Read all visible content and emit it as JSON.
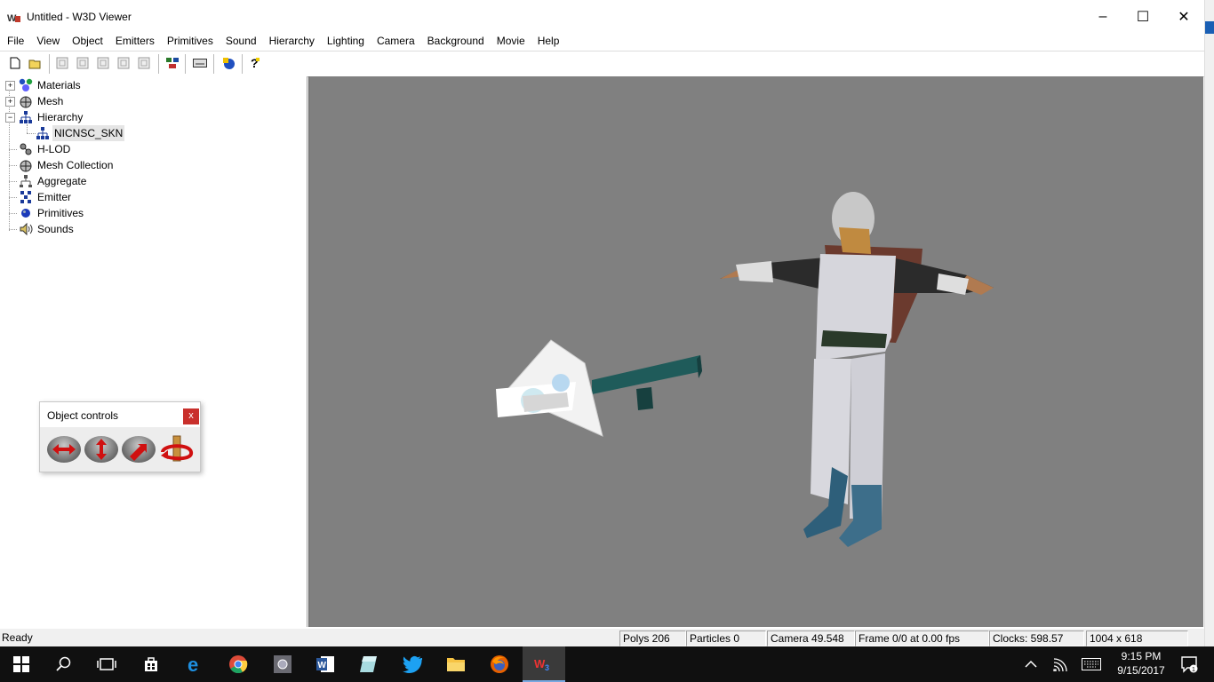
{
  "window": {
    "title": "Untitled - W3D Viewer",
    "minimize": "–",
    "maximize": "☐",
    "close": "✕"
  },
  "menubar": [
    "File",
    "View",
    "Object",
    "Emitters",
    "Primitives",
    "Sound",
    "Hierarchy",
    "Lighting",
    "Camera",
    "Background",
    "Movie",
    "Help"
  ],
  "tree": {
    "materials": "Materials",
    "mesh": "Mesh",
    "hierarchy": "Hierarchy",
    "hierarchy_child": "NICNSC_SKN",
    "hlod": "H-LOD",
    "mesh_collection": "Mesh Collection",
    "aggregate": "Aggregate",
    "emitter": "Emitter",
    "primitives": "Primitives",
    "sounds": "Sounds",
    "expander_plus": "+",
    "expander_minus": "−"
  },
  "object_controls": {
    "title": "Object controls",
    "close": "x"
  },
  "statusbar": {
    "ready": "Ready",
    "polys": "Polys 206",
    "particles": "Particles 0",
    "camera": "Camera 49.548",
    "frame": "Frame 0/0 at 0.00 fps",
    "clocks": "Clocks: 598.57",
    "resolution": "1004 x 618"
  },
  "taskbar": {
    "time": "9:15 PM",
    "date": "9/15/2017"
  },
  "colors": {
    "viewport_bg": "#808080",
    "taskbar_bg": "#101010",
    "close_red": "#c9302c"
  }
}
